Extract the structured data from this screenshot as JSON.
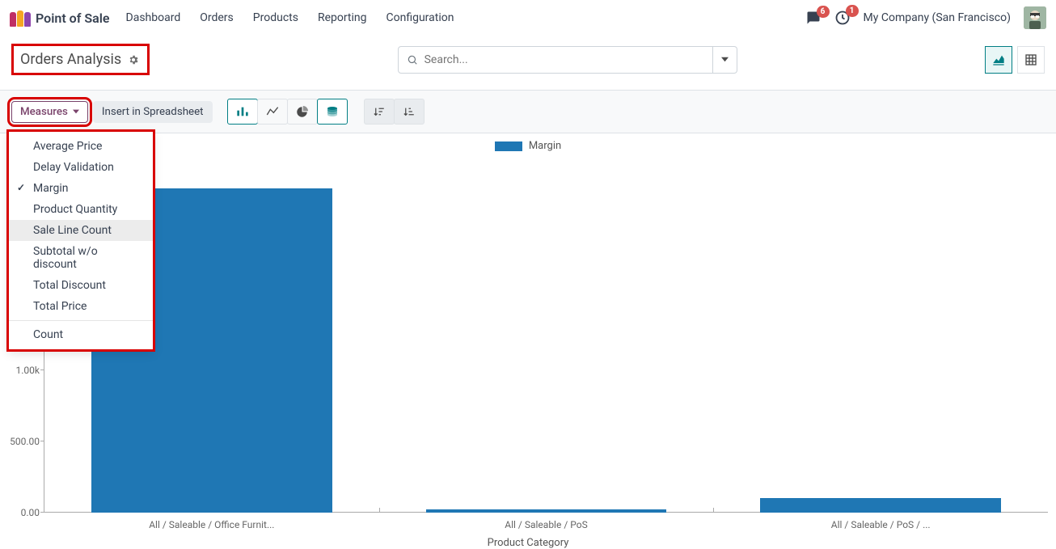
{
  "brand": {
    "app_name": "Point of Sale"
  },
  "nav": {
    "links": [
      "Dashboard",
      "Orders",
      "Products",
      "Reporting",
      "Configuration"
    ]
  },
  "topright": {
    "messages_badge": "6",
    "activities_badge": "1",
    "company": "My Company (San Francisco)"
  },
  "page": {
    "title": "Orders Analysis"
  },
  "search": {
    "placeholder": "Search..."
  },
  "toolbar": {
    "measures_label": "Measures",
    "insert_spreadsheet": "Insert in Spreadsheet"
  },
  "measures_menu": {
    "items": [
      {
        "label": "Average Price",
        "checked": false
      },
      {
        "label": "Delay Validation",
        "checked": false
      },
      {
        "label": "Margin",
        "checked": true
      },
      {
        "label": "Product Quantity",
        "checked": false
      },
      {
        "label": "Sale Line Count",
        "checked": false,
        "hover": true
      },
      {
        "label": "Subtotal w/o discount",
        "checked": false
      },
      {
        "label": "Total Discount",
        "checked": false
      },
      {
        "label": "Total Price",
        "checked": false
      }
    ],
    "footer_item": "Count"
  },
  "chart_data": {
    "type": "bar",
    "title": "",
    "legend": "Margin",
    "categories": [
      "All / Saleable / Office Furnit...",
      "All / Saleable / PoS",
      "All / Saleable / PoS / ..."
    ],
    "values": [
      2280,
      20,
      100
    ],
    "ylim": [
      0,
      2500
    ],
    "yticks": [
      0,
      500,
      1000,
      1500,
      2000,
      2500
    ],
    "ytick_labels": [
      "0.00",
      "500.00",
      "1.00k",
      "",
      "",
      ""
    ],
    "xlabel": "Product Category",
    "ylabel": ""
  },
  "colors": {
    "primary_teal": "#017e84",
    "bar": "#1f77b4",
    "highlight": "#d80000"
  }
}
